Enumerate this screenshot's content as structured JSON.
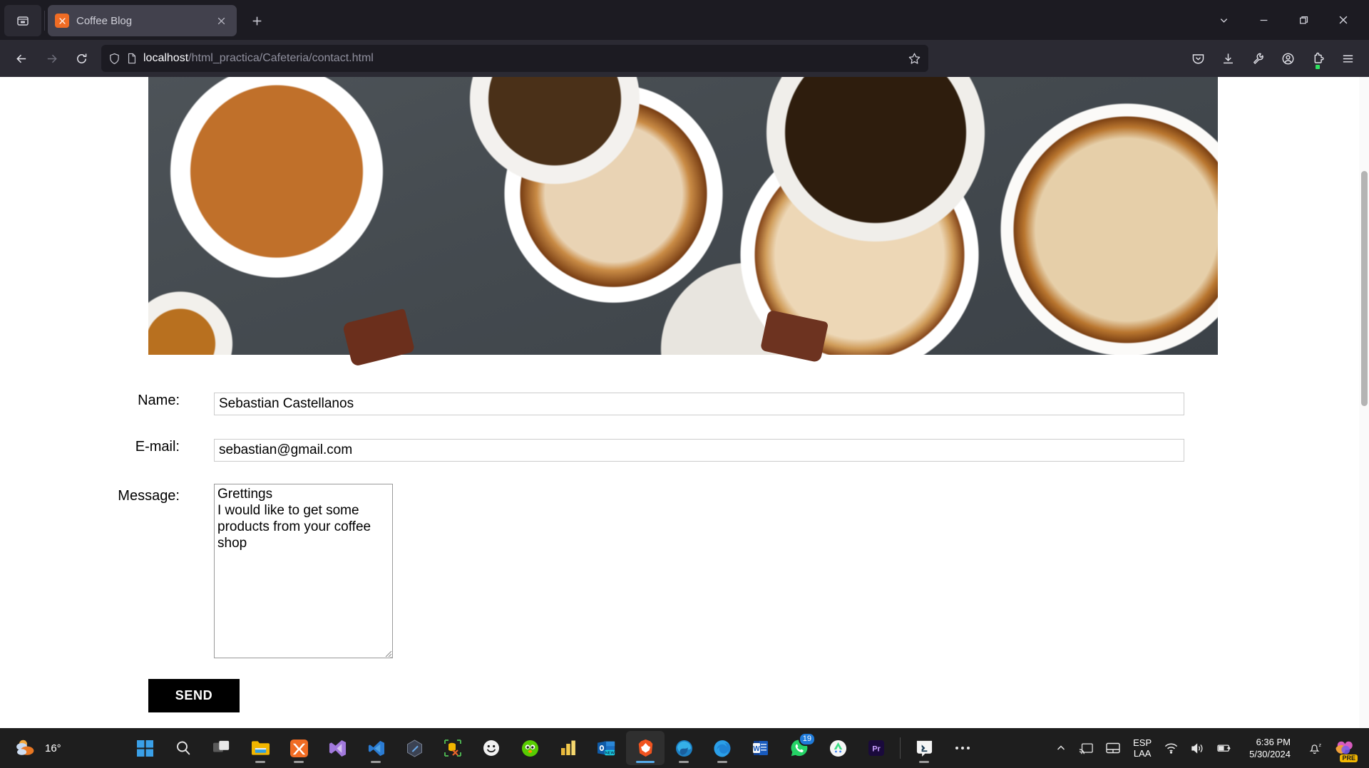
{
  "browser": {
    "tab": {
      "title": "Coffee Blog",
      "favicon": "xampp-icon",
      "close_label": "×"
    },
    "new_tab_label": "+",
    "window_controls": {
      "tab_list": "chevron-down-icon",
      "minimize": "minimize-icon",
      "maximize": "maximize-icon",
      "close": "close-icon"
    },
    "nav": {
      "back": "back-arrow-icon",
      "forward": "forward-arrow-icon",
      "reload": "reload-icon"
    },
    "url": {
      "host": "localhost",
      "path": "/html_practica/Cafeteria/contact.html",
      "shield_icon": "shield-icon",
      "page_icon": "page-icon",
      "bookmark_icon": "star-icon"
    },
    "toolbar_right": [
      {
        "name": "pocket-icon",
        "label": "Save to Pocket"
      },
      {
        "name": "downloads-icon",
        "label": "Downloads"
      },
      {
        "name": "wrench-icon",
        "label": "Tools"
      },
      {
        "name": "account-icon",
        "label": "Account"
      },
      {
        "name": "extensions-icon",
        "label": "Extensions"
      },
      {
        "name": "menu-icon",
        "label": "Open application menu"
      }
    ]
  },
  "page": {
    "hero_image_alt": "Overhead photo of coffee cups on a dark concrete table",
    "form": {
      "fields": [
        {
          "label": "Name:",
          "value": "Sebastian Castellanos",
          "type": "text"
        },
        {
          "label": "E-mail:",
          "value": "sebastian@gmail.com",
          "type": "text"
        },
        {
          "label": "Message:",
          "value": "Grettings\nI would like to get some products from your coffee shop",
          "type": "textarea"
        }
      ],
      "submit_label": "SEND"
    }
  },
  "taskbar": {
    "weather": {
      "temp": "16°",
      "icon": "weather-cloudy-sun-icon"
    },
    "apps": [
      {
        "name": "start-button",
        "label": "Start"
      },
      {
        "name": "search-button",
        "label": "Search"
      },
      {
        "name": "task-view-button",
        "label": "Task View"
      },
      {
        "name": "file-explorer",
        "label": "File Explorer",
        "running": true
      },
      {
        "name": "xampp",
        "label": "XAMPP Control Panel",
        "running": true
      },
      {
        "name": "visual-studio",
        "label": "Visual Studio"
      },
      {
        "name": "vs-code",
        "label": "Visual Studio Code",
        "running": true
      },
      {
        "name": "insomnia",
        "label": "Insomnia"
      },
      {
        "name": "mysql-workbench",
        "label": "MySQL Workbench"
      },
      {
        "name": "smiley-app",
        "label": "Smiley"
      },
      {
        "name": "duolingo",
        "label": "Duolingo"
      },
      {
        "name": "power-bi",
        "label": "Power BI"
      },
      {
        "name": "outlook-new",
        "label": "Outlook (new)",
        "badge": "NEW"
      },
      {
        "name": "brave-browser",
        "label": "Brave",
        "active": true
      },
      {
        "name": "microsoft-edge",
        "label": "Microsoft Edge",
        "running": true
      },
      {
        "name": "firefox",
        "label": "Firefox",
        "running": true
      },
      {
        "name": "microsoft-word",
        "label": "Microsoft Word"
      },
      {
        "name": "whatsapp",
        "label": "WhatsApp",
        "badge": "19"
      },
      {
        "name": "android-studio",
        "label": "Android Studio"
      },
      {
        "name": "premiere-pro",
        "label": "Adobe Premiere Pro",
        "short": "Pr"
      },
      {
        "name": "azure-data-studio",
        "label": "Azure Data Studio",
        "running": true
      },
      {
        "name": "taskbar-overflow",
        "label": "···"
      }
    ],
    "tray": {
      "overflow": "chevron-up-icon",
      "cast": "cast-icon",
      "touchpad": "touchpad-icon",
      "language_top": "ESP",
      "language_bottom": "LAA",
      "wifi": "wifi-icon",
      "volume": "volume-icon",
      "battery": "battery-charging-icon",
      "time": "6:36 PM",
      "date": "5/30/2024",
      "notifications": "bell-dnd-icon",
      "copilot": "copilot-icon",
      "copilot_badge": "PRE"
    }
  },
  "colors": {
    "chrome_bg": "#2b2a33",
    "tabstrip_bg": "#1c1b22",
    "active_tab": "#42414d",
    "page_bg": "#ffffff",
    "button_bg": "#000000",
    "taskbar_bg": "#1e1e1e",
    "accent": "#0078d4"
  }
}
